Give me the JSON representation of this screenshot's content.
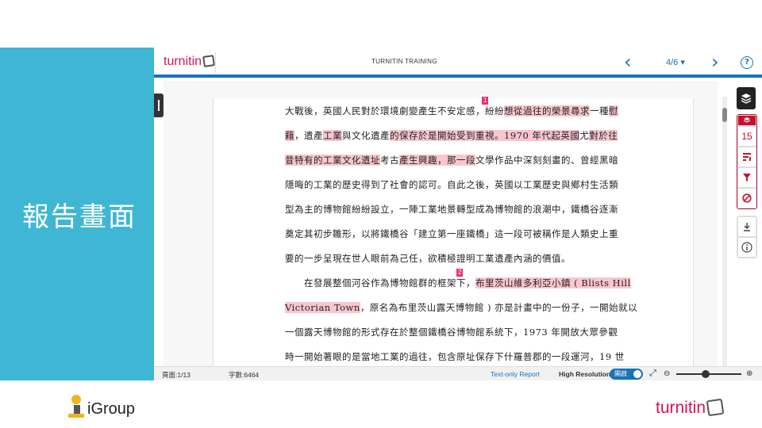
{
  "slide": {
    "title": "報告畫面",
    "igroup_logo": "iGroup",
    "brand_logo": "turnitin"
  },
  "toolbar": {
    "logo": "turnitin",
    "title": "TURNITIN TRAINING",
    "page_indicator": "4/6 ▾",
    "prev_icon": "‹",
    "next_icon": "›",
    "help_icon": "?"
  },
  "document": {
    "lines": [
      [
        {
          "t": "大戰後，英國人民對於環境劇變產生不安定感，紛紛"
        },
        {
          "t": "想從過往的榮景尋求",
          "h": true
        },
        {
          "t": "一種"
        },
        {
          "t": "慰",
          "h": true
        }
      ],
      [
        {
          "t": "藉",
          "h": true
        },
        {
          "t": "，遺產"
        },
        {
          "t": "工業",
          "h": true
        },
        {
          "t": "與文化遺產"
        },
        {
          "t": "的保存於是開始受到重視。1970 年代起英國",
          "h": true
        },
        {
          "t": "尤"
        },
        {
          "t": "對於往",
          "h": true
        }
      ],
      [
        {
          "t": "昔特有的工業文化遺址",
          "h": true
        },
        {
          "t": "考古"
        },
        {
          "t": "產生興趣，那一段",
          "h": true
        },
        {
          "t": "文學作品中深刻刻畫的、曾經黑暗"
        }
      ],
      [
        {
          "t": "隱晦的工業的歷史得到了社會的認可。自此之後，英國以工業歷史與鄉村生活類"
        }
      ],
      [
        {
          "t": "型為主的博物館紛紛設立，一陣工業地景轉型成為博物館的浪潮中，鐵橋谷逐漸"
        }
      ],
      [
        {
          "t": "奠定其初步雛形，以將鐵橋谷「建立第一座鐵橋」這一段可被稱作是人類史上重"
        }
      ],
      [
        {
          "t": "要的一步呈現在世人眼前為己任，欲積極證明工業遺產內涵的價值。"
        }
      ],
      [
        {
          "t": "　　在發展整個河谷作為博物館群的框架下，"
        },
        {
          "t": "布里茨山維多利亞小鎮 ( Blists Hill",
          "h": true
        }
      ],
      [
        {
          "t": "Victorian Town",
          "h": true
        },
        {
          "t": "，原名為布里茨山露天博物館 ) 亦是計畫中的一份子，一開始就以"
        }
      ],
      [
        {
          "t": "一個露天博物館的形式存在於整個鐵橋谷博物館系統下，1973 年開放大眾參觀"
        }
      ],
      [
        {
          "t": "時一開始著眼的是當地工業的過往，包含原址保存下什羅普郡的一段運河，19 世"
        }
      ]
    ],
    "markers": [
      "1",
      "2"
    ]
  },
  "right_panel": {
    "layers_icon": "layers-icon",
    "match_count": "15",
    "filter_icons": [
      "match-overview-icon",
      "filter-icon",
      "exclude-icon"
    ],
    "tool_icons": [
      "download-icon",
      "info-icon"
    ]
  },
  "statusbar": {
    "page": "頁面:1/13",
    "word_count": "字數:6464",
    "text_only": "Text-only Report",
    "high_res": "High Resolution",
    "toggle": "開啟",
    "zoom_level": 0.45
  },
  "colors": {
    "band": "#3fb6d3",
    "accent": "#1a73b8",
    "match_highlight": "#f9c6cf",
    "brand_red": "#d4145a"
  }
}
